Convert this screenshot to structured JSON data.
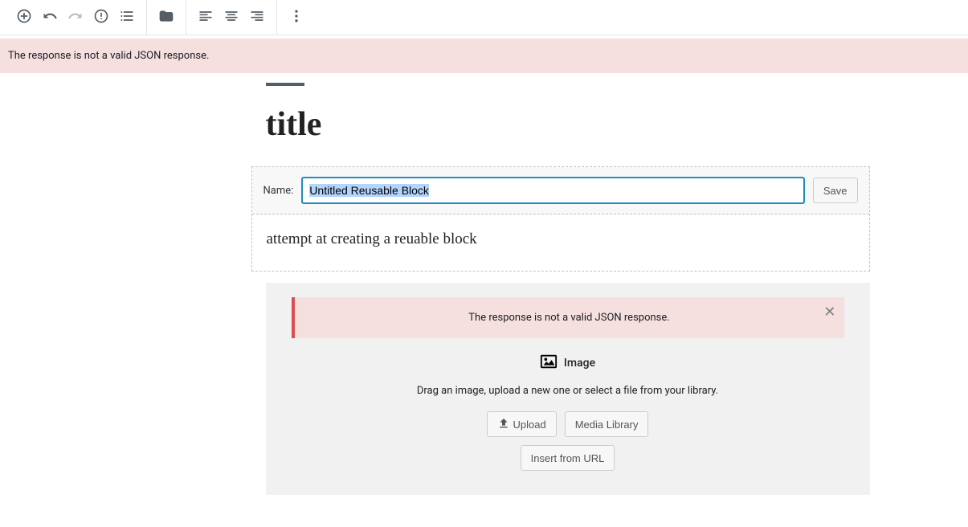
{
  "error_banner": "The response is not a valid JSON response.",
  "post": {
    "title": "title"
  },
  "reusable": {
    "name_label": "Name:",
    "name_value": "Untitled Reusable Block",
    "save_label": "Save",
    "paragraph": "attempt at creating a reuable block"
  },
  "image_block": {
    "error": "The response is not a valid JSON response.",
    "label": "Image",
    "instructions": "Drag an image, upload a new one or select a file from your library.",
    "upload_label": "Upload",
    "media_library_label": "Media Library",
    "insert_url_label": "Insert from URL"
  }
}
